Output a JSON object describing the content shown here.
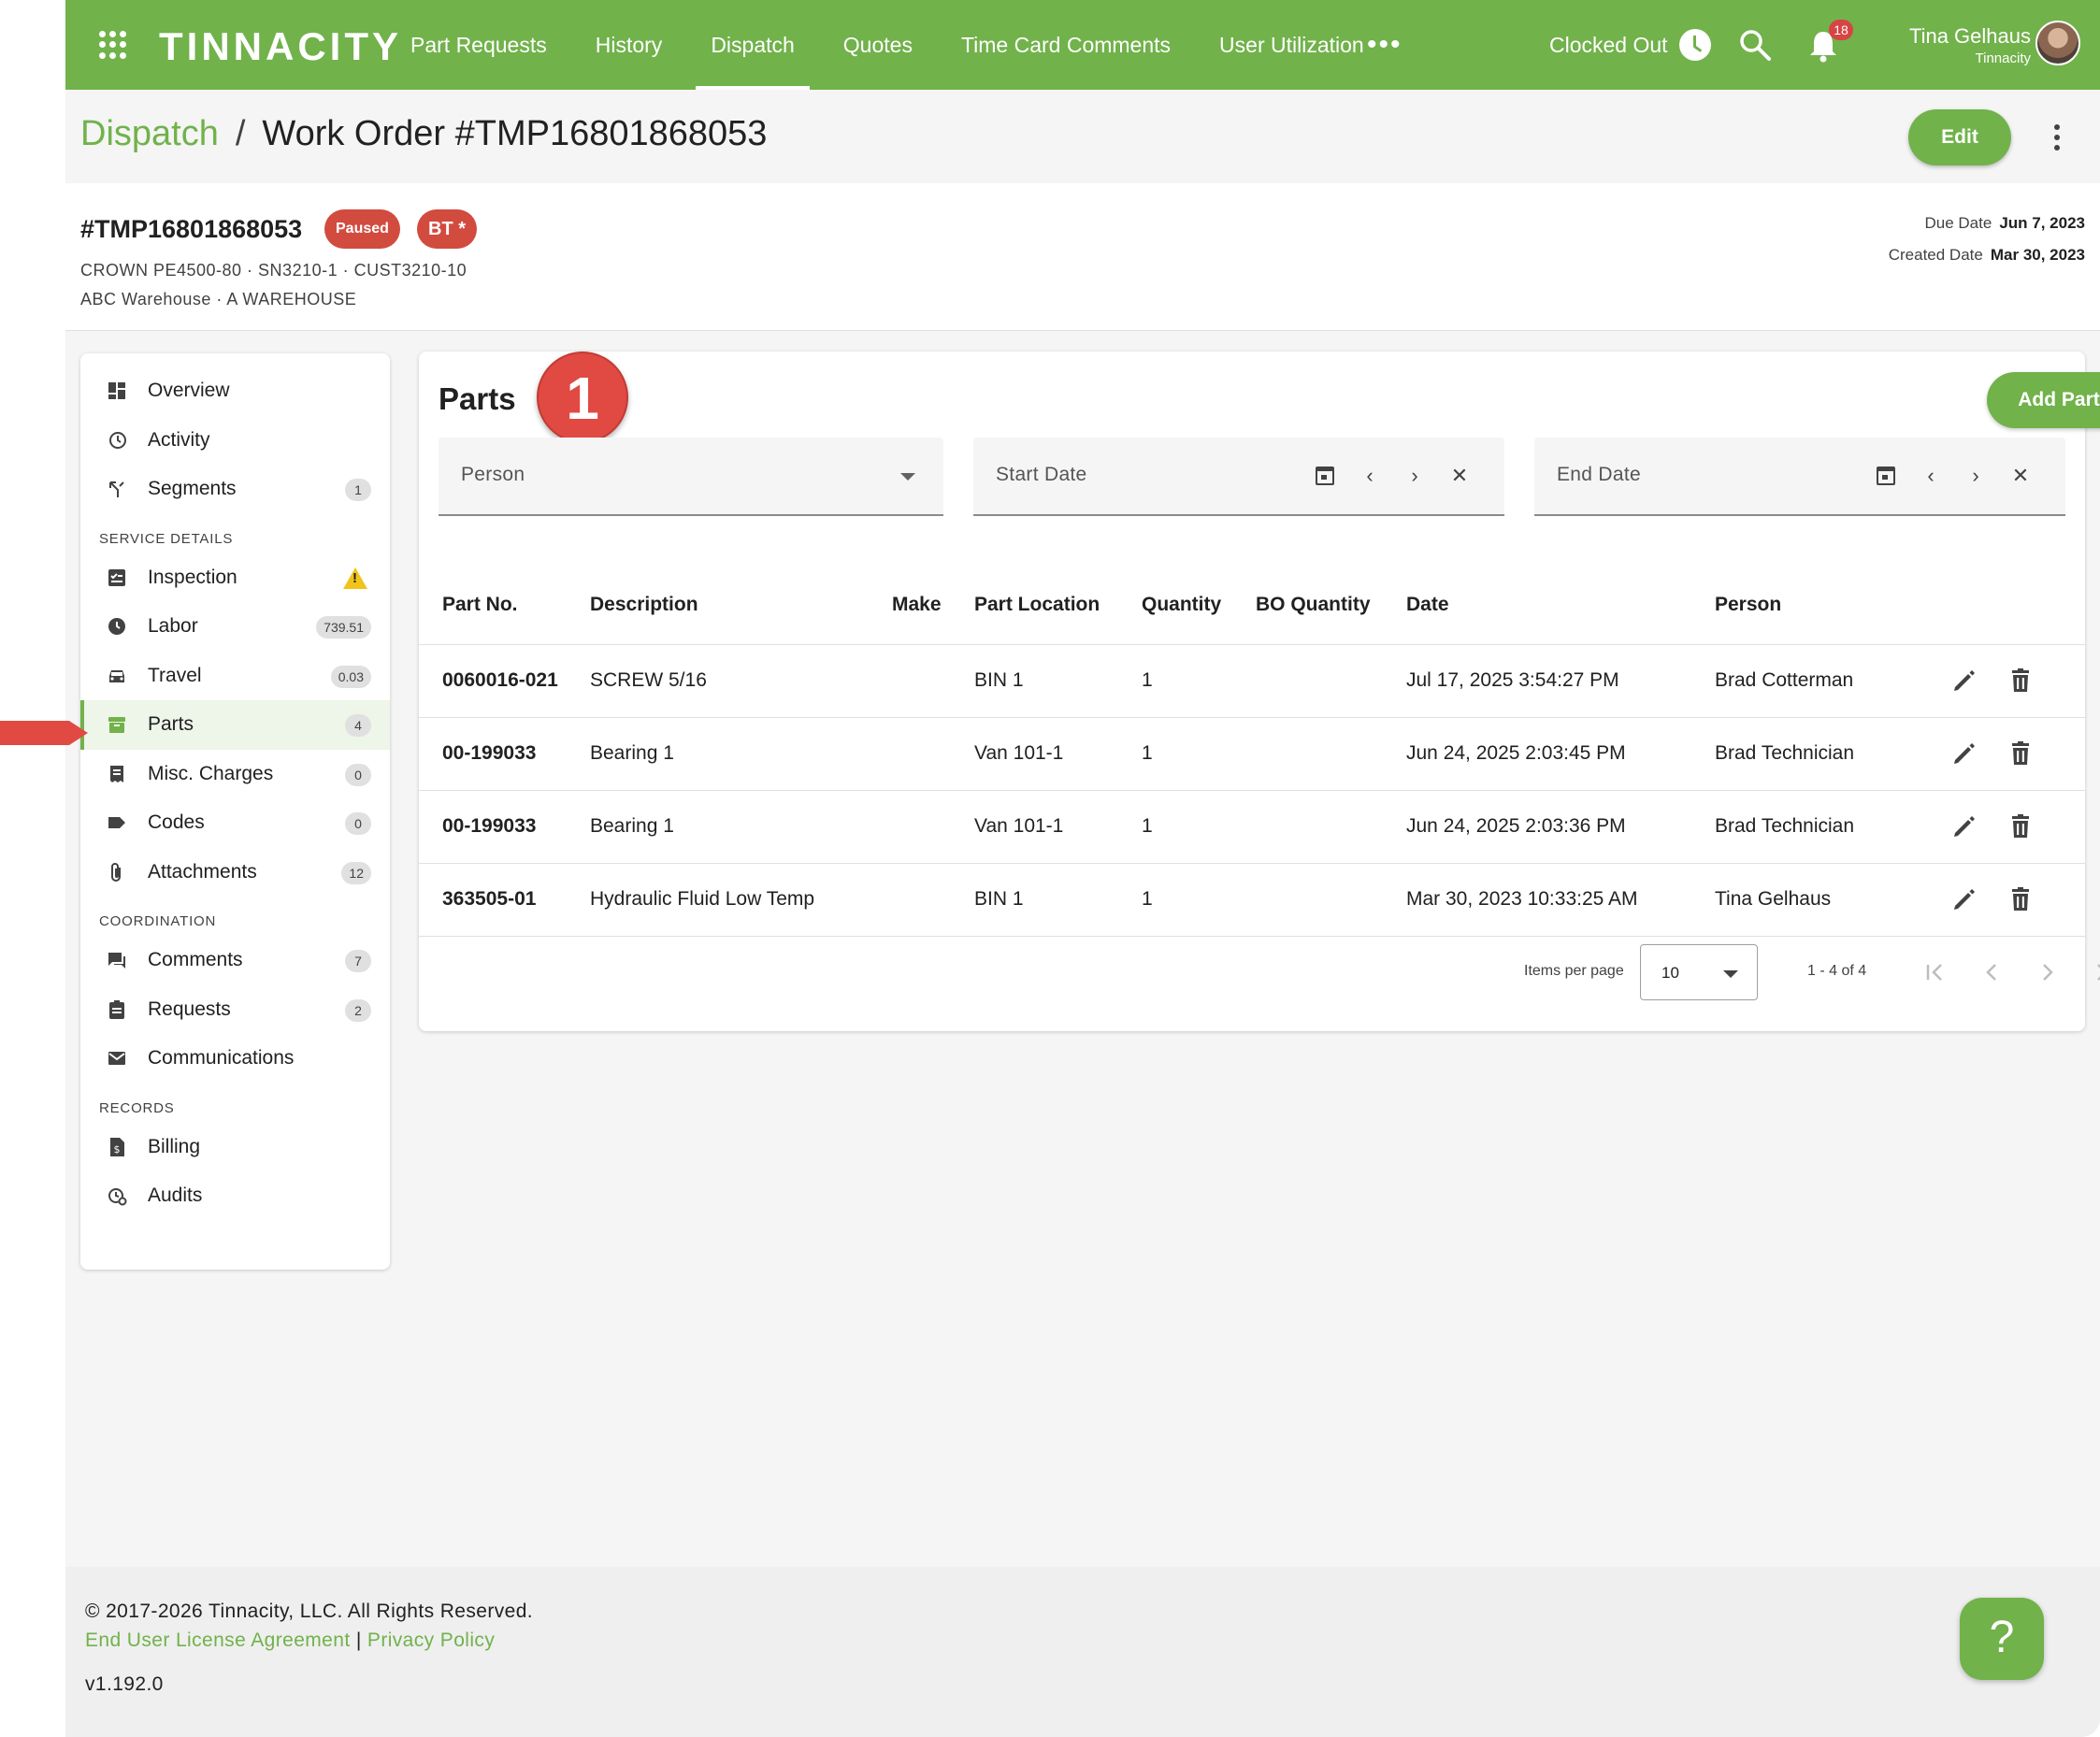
{
  "topbar": {
    "logo": "TINNACITY",
    "nav": [
      "Part Requests",
      "History",
      "Dispatch",
      "Quotes",
      "Time Card Comments",
      "User Utilization"
    ],
    "active_nav": "Dispatch",
    "more": "•••",
    "clock_status": "Clocked Out",
    "notification_count": "18",
    "user_name": "Tina Gelhaus",
    "user_org": "Tinnacity"
  },
  "breadcrumb": {
    "parent": "Dispatch",
    "separator": "/",
    "current": "Work Order #TMP16801868053"
  },
  "actions": {
    "edit_label": "Edit"
  },
  "work_order": {
    "id": "#TMP16801868053",
    "status": "Paused",
    "tag": "BT *",
    "equipment": "CROWN PE4500-80 · SN3210-1 · CUST3210-10",
    "location": "ABC Warehouse · A WAREHOUSE",
    "due_date_label": "Due Date",
    "due_date": "Jun 7, 2023",
    "created_date_label": "Created Date",
    "created_date": "Mar 30, 2023"
  },
  "sidebar": {
    "top": [
      {
        "label": "Overview",
        "icon": "dashboard-icon"
      },
      {
        "label": "Activity",
        "icon": "history-icon"
      },
      {
        "label": "Segments",
        "icon": "segments-icon",
        "badge": "1"
      }
    ],
    "service_title": "SERVICE DETAILS",
    "service": [
      {
        "label": "Inspection",
        "icon": "checklist-icon",
        "warning": true
      },
      {
        "label": "Labor",
        "icon": "clock-icon",
        "badge": "739.51"
      },
      {
        "label": "Travel",
        "icon": "car-icon",
        "badge": "0.03"
      },
      {
        "label": "Parts",
        "icon": "box-icon",
        "badge": "4",
        "active": true
      },
      {
        "label": "Misc. Charges",
        "icon": "receipt-icon",
        "badge": "0"
      },
      {
        "label": "Codes",
        "icon": "tag-icon",
        "badge": "0"
      },
      {
        "label": "Attachments",
        "icon": "paperclip-icon",
        "badge": "12"
      }
    ],
    "coordination_title": "COORDINATION",
    "coordination": [
      {
        "label": "Comments",
        "icon": "comment-icon",
        "badge": "7"
      },
      {
        "label": "Requests",
        "icon": "clipboard-icon",
        "badge": "2"
      },
      {
        "label": "Communications",
        "icon": "mail-icon"
      }
    ],
    "records_title": "RECORDS",
    "records": [
      {
        "label": "Billing",
        "icon": "invoice-icon"
      },
      {
        "label": "Audits",
        "icon": "audit-icon"
      }
    ]
  },
  "parts": {
    "title": "Parts",
    "step_marker": "1",
    "add_label": "Add Part",
    "filters": {
      "person_placeholder": "Person",
      "start_placeholder": "Start Date",
      "end_placeholder": "End Date"
    },
    "columns": [
      "Part No.",
      "Description",
      "Make",
      "Part Location",
      "Quantity",
      "BO Quantity",
      "Date",
      "Person"
    ],
    "rows": [
      {
        "part_no": "0060016-021",
        "description": "SCREW 5/16",
        "make": "",
        "location": "BIN 1",
        "quantity": "1",
        "bo_quantity": "",
        "date": "Jul 17, 2025 3:54:27 PM",
        "person": "Brad Cotterman"
      },
      {
        "part_no": "00-199033",
        "description": "Bearing 1",
        "make": "",
        "location": "Van 101-1",
        "quantity": "1",
        "bo_quantity": "",
        "date": "Jun 24, 2025 2:03:45 PM",
        "person": "Brad Technician"
      },
      {
        "part_no": "00-199033",
        "description": "Bearing 1",
        "make": "",
        "location": "Van 101-1",
        "quantity": "1",
        "bo_quantity": "",
        "date": "Jun 24, 2025 2:03:36 PM",
        "person": "Brad Technician"
      },
      {
        "part_no": "363505-01",
        "description": "Hydraulic Fluid Low Temp",
        "make": "",
        "location": "BIN 1",
        "quantity": "1",
        "bo_quantity": "",
        "date": "Mar 30, 2023 10:33:25 AM",
        "person": "Tina Gelhaus"
      }
    ],
    "pager": {
      "items_per_page_label": "Items per page",
      "items_per_page": "10",
      "range": "1 - 4 of 4"
    }
  },
  "footer": {
    "copyright": "© 2017-2026 Tinnacity, LLC. All Rights Reserved.",
    "eula": "End User License Agreement",
    "divider": "|",
    "privacy": "Privacy Policy",
    "version": "v1.192.0"
  },
  "help": {
    "label": "?"
  },
  "colors": {
    "brand": "#71b24b",
    "danger": "#d24b3f",
    "marker": "#e04a43"
  }
}
